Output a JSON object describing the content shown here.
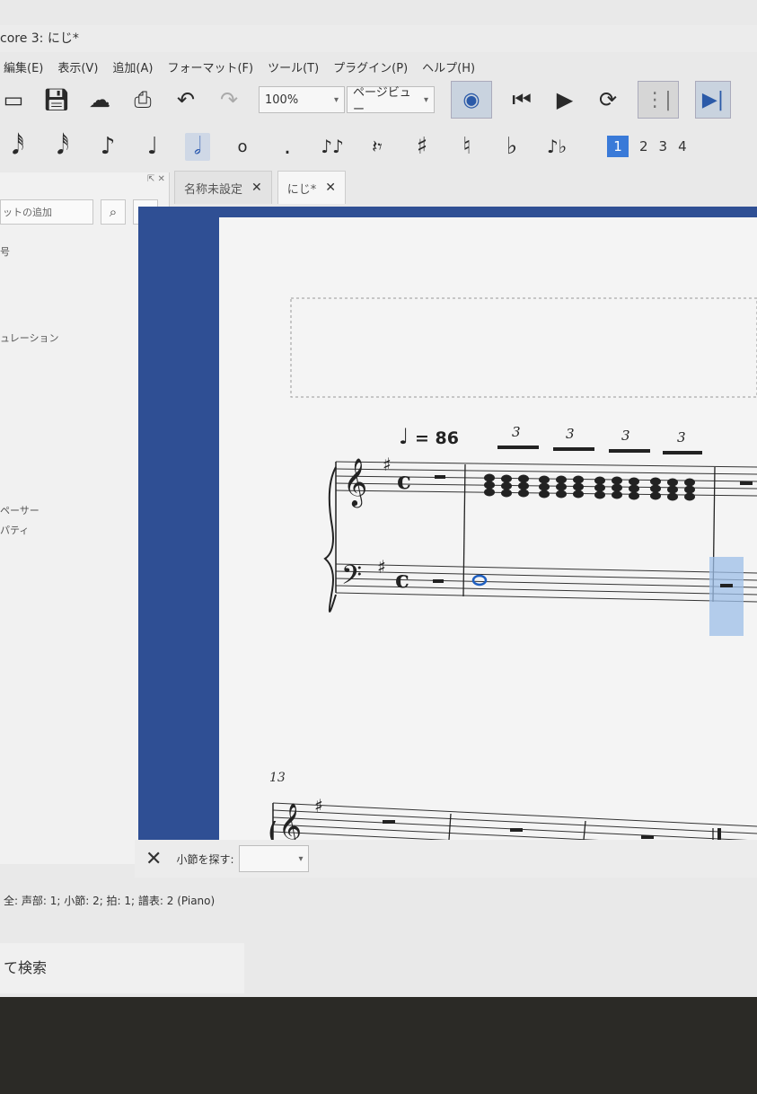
{
  "window": {
    "title": "core 3: にじ*"
  },
  "menu": [
    "編集(E)",
    "表示(V)",
    "追加(A)",
    "フォーマット(F)",
    "ツール(T)",
    "プラグイン(P)",
    "ヘルプ(H)"
  ],
  "toolbar": {
    "zoom": "100%",
    "view_mode": "ページビュー"
  },
  "note_input": {
    "voices": [
      "1",
      "2",
      "3",
      "4"
    ]
  },
  "palette": {
    "search_placeholder": "ットの追加",
    "search_icon": "search-icon",
    "more_label": "···",
    "items": [
      "号",
      "ュレーション",
      "ペーサー",
      "パティ"
    ]
  },
  "tabs": [
    {
      "label": "名称未設定"
    },
    {
      "label": "にじ*"
    }
  ],
  "score": {
    "tempo": "= 86",
    "tuplet_numbers": [
      "3",
      "3",
      "3",
      "3"
    ],
    "measure_number": "13"
  },
  "find_bar": {
    "label": "小節を探す:"
  },
  "status": {
    "text": "全: 声部: 1; 小節: 2; 拍: 1; 譜表: 2 (Piano)"
  },
  "taskbar": {
    "search_text": "て検索"
  }
}
